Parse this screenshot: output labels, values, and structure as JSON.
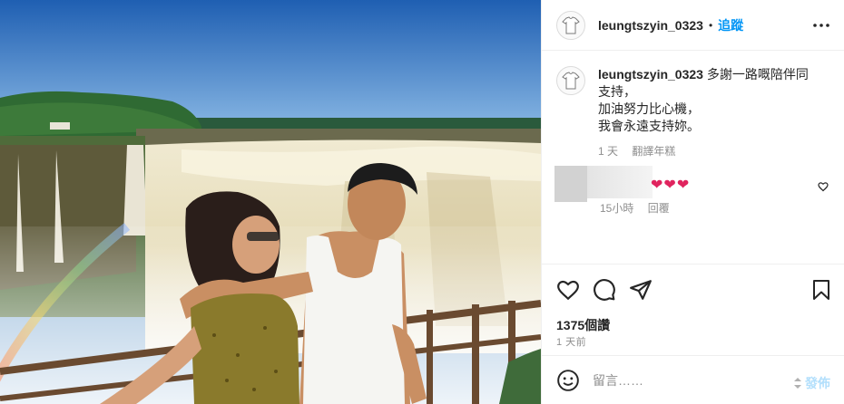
{
  "post": {
    "username": "leungtszyin_0323",
    "follow_label": "追蹤",
    "separator": "•",
    "caption_first": "多謝一路嘅陪伴同",
    "caption_lines": [
      "支持，",
      "加油努力比心機，",
      "我會永遠支持妳。"
    ],
    "caption_age": "1 天",
    "translate_label": "翻譯年糕"
  },
  "comment": {
    "text": "❤❤❤",
    "age": "15小時",
    "reply_label": "回覆"
  },
  "stats": {
    "views": "1375個讚",
    "posted": "1 天前"
  },
  "add_comment": {
    "placeholder": "留言……",
    "post_label": "發佈"
  },
  "icons": {
    "more": "more-dots-icon",
    "like": "heart-icon",
    "comment": "comment-bubble-icon",
    "share": "paper-plane-icon",
    "save": "bookmark-icon",
    "emoji": "emoji-smile-icon",
    "avatar": "shirt-avatar-icon"
  },
  "colors": {
    "accent": "#0095f6",
    "heart": "#e0245e",
    "muted": "#8e8e8e",
    "post_disabled": "#b2dffc"
  }
}
